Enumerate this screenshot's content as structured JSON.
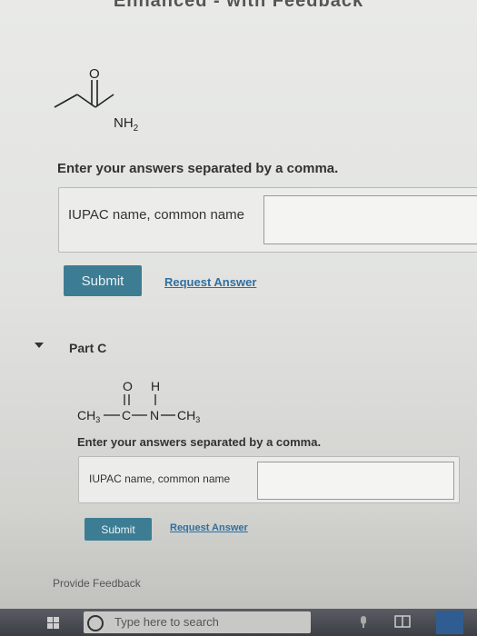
{
  "header": {
    "title": "Enhanced - with Feedback"
  },
  "partB": {
    "molecule": {
      "O": "O",
      "NH2": "NH",
      "NH2_sub": "2"
    },
    "prompt": "Enter your answers separated by a comma.",
    "placeholder": "IUPAC name, common name",
    "submit": "Submit",
    "request": "Request Answer"
  },
  "partC": {
    "title": "Part C",
    "molecule": {
      "O": "O",
      "H": "H",
      "CH3a": "CH",
      "CH3a_sub": "3",
      "C": "C",
      "N": "N",
      "CH3b": "CH",
      "CH3b_sub": "3"
    },
    "prompt": "Enter your answers separated by a comma.",
    "placeholder": "IUPAC name, common name",
    "submit": "Submit",
    "request": "Request Answer"
  },
  "feedback": "Provide Feedback",
  "taskbar": {
    "search_placeholder": "Type here to search"
  }
}
